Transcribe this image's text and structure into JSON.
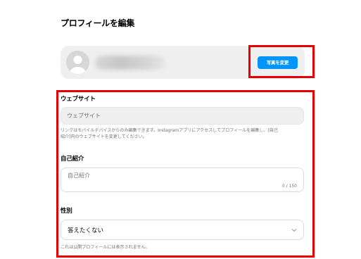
{
  "page_title": "プロフィールを編集",
  "profile": {
    "change_photo_label": "写真を変更"
  },
  "website": {
    "label": "ウェブサイト",
    "placeholder": "ウェブサイト",
    "help_text_line1": "リンクはモバイルデバイスからのみ編集できます。Instagramアプリにアクセスしてプロフィールを編集し、[自己",
    "help_text_line2": "紹介]内のウェブサイトを変更してください。"
  },
  "bio": {
    "label": "自己紹介",
    "placeholder": "自己紹介",
    "counter": "0 / 150"
  },
  "gender": {
    "label": "性別",
    "selected": "答えたくない",
    "help_text": "これは公開プロフィールには表示されません。"
  },
  "colors": {
    "accent": "#0095f6",
    "highlight": "#e60000",
    "card_bg": "#efefef"
  },
  "icons": {
    "avatar": "default-avatar-icon",
    "select": "chevron-down-icon"
  }
}
